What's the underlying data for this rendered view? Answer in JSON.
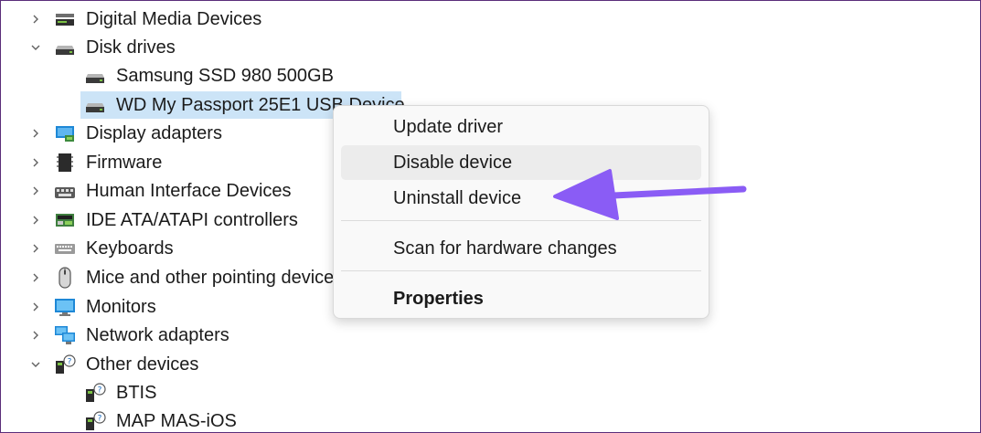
{
  "tree": {
    "items": [
      {
        "label": "Digital Media Devices",
        "expanded": false,
        "icon": "media-device-icon"
      },
      {
        "label": "Disk drives",
        "expanded": true,
        "icon": "disk-drive-icon"
      },
      {
        "label": "Samsung SSD 980 500GB",
        "child": true,
        "icon": "disk-drive-icon"
      },
      {
        "label": "WD My Passport 25E1 USB Device",
        "child": true,
        "selected": true,
        "icon": "disk-drive-icon"
      },
      {
        "label": "Display adapters",
        "expanded": false,
        "icon": "display-adapter-icon"
      },
      {
        "label": "Firmware",
        "expanded": false,
        "icon": "firmware-icon"
      },
      {
        "label": "Human Interface Devices",
        "expanded": false,
        "icon": "hid-icon"
      },
      {
        "label": "IDE ATA/ATAPI controllers",
        "expanded": false,
        "icon": "ide-controller-icon"
      },
      {
        "label": "Keyboards",
        "expanded": false,
        "icon": "keyboard-icon"
      },
      {
        "label": "Mice and other pointing devices",
        "expanded": false,
        "icon": "mouse-icon"
      },
      {
        "label": "Monitors",
        "expanded": false,
        "icon": "monitor-icon"
      },
      {
        "label": "Network adapters",
        "expanded": false,
        "icon": "network-adapter-icon"
      },
      {
        "label": "Other devices",
        "expanded": true,
        "icon": "unknown-device-icon"
      },
      {
        "label": "BTIS",
        "child": true,
        "icon": "unknown-device-icon"
      },
      {
        "label": "MAP MAS-iOS",
        "child": true,
        "icon": "unknown-device-icon"
      }
    ]
  },
  "context_menu": {
    "items": [
      {
        "label": "Update driver"
      },
      {
        "label": "Disable device",
        "hover": true
      },
      {
        "label": "Uninstall device"
      },
      {
        "label": "Scan for hardware changes"
      },
      {
        "label": "Properties",
        "bold": true
      }
    ]
  },
  "colors": {
    "selection": "#cce4f7",
    "annotation_arrow": "#8a5cf5",
    "frame_border": "#5a2e7a"
  }
}
